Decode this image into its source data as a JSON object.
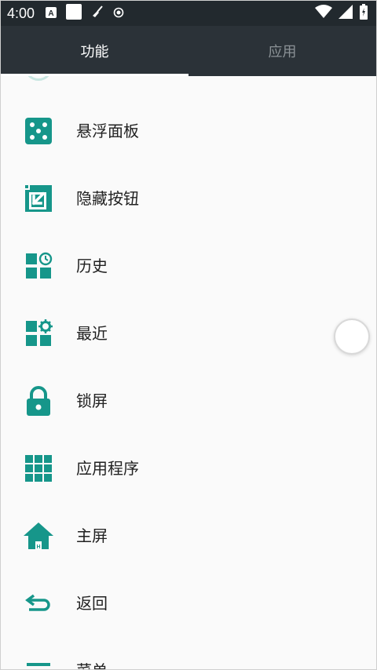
{
  "status_bar": {
    "time": "4:00",
    "icons": [
      "a-badge-icon",
      "white-square-icon",
      "broom-icon",
      "record-icon"
    ],
    "right_icons": [
      "wifi-icon",
      "signal-icon",
      "battery-icon"
    ]
  },
  "tabs": [
    {
      "label": "功能",
      "active": true
    },
    {
      "label": "应用",
      "active": false
    }
  ],
  "items": [
    {
      "label": "悬浮面板",
      "icon": "dice-panel-icon"
    },
    {
      "label": "隐藏按钮",
      "icon": "hide-arrow-icon"
    },
    {
      "label": "历史",
      "icon": "history-grid-icon"
    },
    {
      "label": "最近",
      "icon": "recent-grid-gear-icon"
    },
    {
      "label": "锁屏",
      "icon": "lock-icon"
    },
    {
      "label": "应用程序",
      "icon": "apps-grid-icon"
    },
    {
      "label": "主屏",
      "icon": "home-icon"
    },
    {
      "label": "返回",
      "icon": "back-icon"
    },
    {
      "label": "菜单",
      "icon": "menu-icon"
    }
  ],
  "colors": {
    "accent": "#16968a",
    "tabbar": "#2b3238",
    "status_bar": "#22292e",
    "background": "#fafafa"
  }
}
